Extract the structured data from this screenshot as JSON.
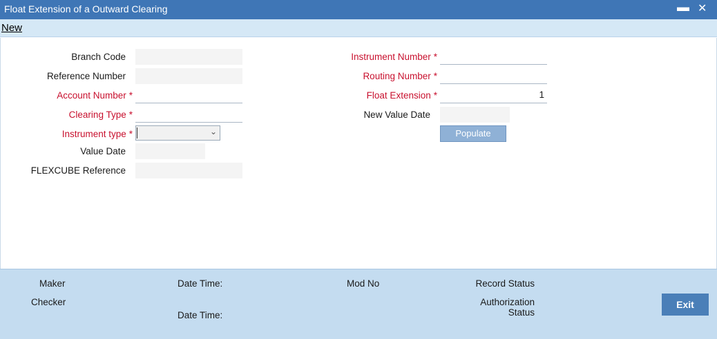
{
  "window": {
    "title": "Float Extension of a Outward Clearing",
    "minimize": "▬",
    "close": "✕"
  },
  "toolbar": {
    "new_label": "New"
  },
  "form": {
    "left": {
      "branch_code": {
        "label": "Branch Code",
        "value": ""
      },
      "reference_number": {
        "label": "Reference Number",
        "value": ""
      },
      "account_number": {
        "label": "Account Number",
        "value": ""
      },
      "clearing_type": {
        "label": "Clearing Type",
        "value": ""
      },
      "instrument_type": {
        "label": "Instrument type",
        "value": ""
      },
      "value_date": {
        "label": "Value Date",
        "value": ""
      },
      "flexcube_reference": {
        "label": "FLEXCUBE Reference",
        "value": ""
      }
    },
    "right": {
      "instrument_number": {
        "label": "Instrument Number",
        "value": ""
      },
      "routing_number": {
        "label": "Routing Number",
        "value": ""
      },
      "float_extension": {
        "label": "Float Extension",
        "value": "1"
      },
      "new_value_date": {
        "label": "New Value Date",
        "value": ""
      }
    },
    "required_mark": "*",
    "populate_label": "Populate"
  },
  "footer": {
    "maker": "Maker",
    "checker": "Checker",
    "date_time_1": "Date Time:",
    "date_time_2": "Date Time:",
    "mod_no": "Mod No",
    "record_status": "Record Status",
    "authorization_status_line1": "Authorization",
    "authorization_status_line2": "Status",
    "exit_label": "Exit"
  },
  "colors": {
    "titlebar": "#3f76b6",
    "required": "#c8102e",
    "footer": "#c4dcf0",
    "button": "#4a7fb8"
  }
}
